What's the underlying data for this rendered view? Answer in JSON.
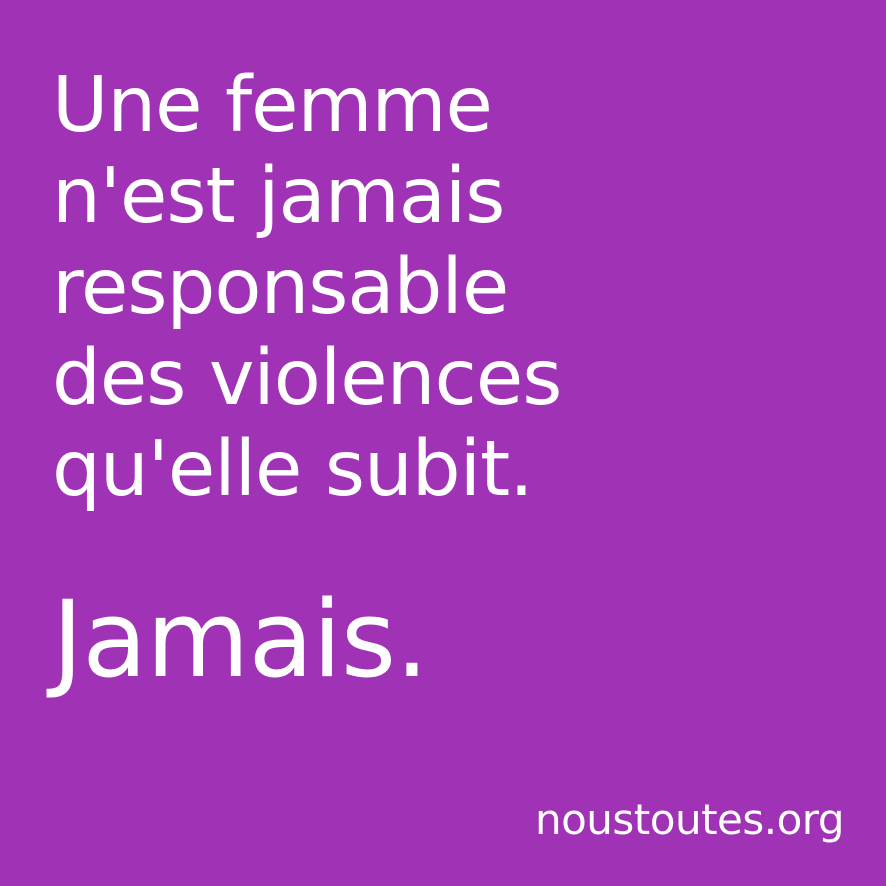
{
  "poster": {
    "background_color": "#a033b5",
    "text_color": "#ffffff",
    "statement_lines": [
      "Une femme",
      "n'est jamais",
      "responsable",
      "des violences",
      "qu'elle subit."
    ],
    "emphasis": "Jamais.",
    "site": "noustoutes.org"
  }
}
